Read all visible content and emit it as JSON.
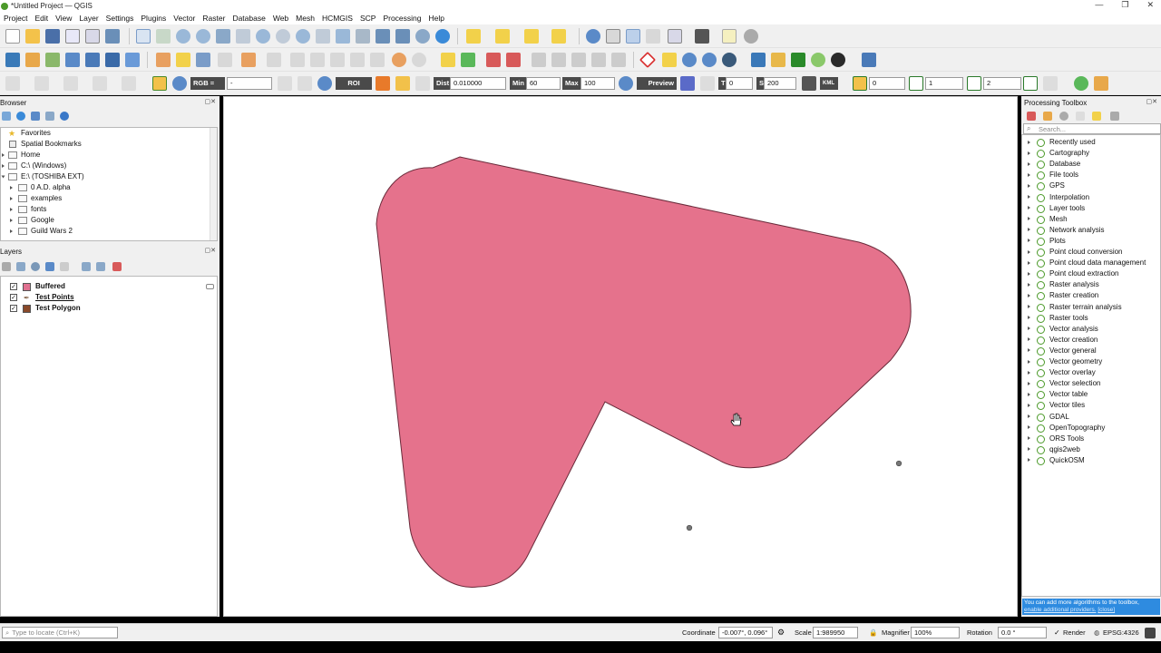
{
  "window": {
    "title": "*Untitled Project — QGIS",
    "buttons": [
      "—",
      "❐",
      "✕"
    ]
  },
  "menu": [
    "Project",
    "Edit",
    "View",
    "Layer",
    "Settings",
    "Plugins",
    "Vector",
    "Raster",
    "Database",
    "Web",
    "Mesh",
    "HCMGIS",
    "SCP",
    "Processing",
    "Help"
  ],
  "scp_toolbar": {
    "rgb_label": "RGB =",
    "rgb_value": "-",
    "roi_label": "ROI",
    "dist_label": "Dist",
    "dist_value": "0.010000",
    "min_label": "Min",
    "min_value": "60",
    "max_label": "Max",
    "max_value": "100",
    "preview_label": "Preview",
    "t_label": "T",
    "t_value": "0",
    "s_label": "S",
    "s_value": "200",
    "kml_label": "KML",
    "band_value": "0",
    "step1_value": "1",
    "step2_value": "2"
  },
  "browser": {
    "title": "Browser",
    "items": [
      "Favorites",
      "Spatial Bookmarks",
      "Home",
      "C:\\ (Windows)",
      "E:\\ (TOSHIBA EXT)",
      "0 A.D. alpha",
      "examples",
      "fonts",
      "Google",
      "Guild Wars 2"
    ]
  },
  "layers": {
    "title": "Layers",
    "items": [
      {
        "name": "Buffered",
        "checked": "✓",
        "color": "#e07090"
      },
      {
        "name": "Test Points",
        "checked": "✓",
        "color": "#8a6a50"
      },
      {
        "name": "Test Polygon",
        "checked": "✓",
        "color": "#8a4a2a"
      }
    ]
  },
  "processing": {
    "title": "Processing Toolbox",
    "search_placeholder": "Search...",
    "items": [
      "Recently used",
      "Cartography",
      "Database",
      "File tools",
      "GPS",
      "Interpolation",
      "Layer tools",
      "Mesh",
      "Network analysis",
      "Plots",
      "Point cloud conversion",
      "Point cloud data management",
      "Point cloud extraction",
      "Raster analysis",
      "Raster creation",
      "Raster terrain analysis",
      "Raster tools",
      "Vector analysis",
      "Vector creation",
      "Vector general",
      "Vector geometry",
      "Vector overlay",
      "Vector selection",
      "Vector table",
      "Vector tiles",
      "GDAL",
      "OpenTopography",
      "ORS Tools",
      "qgis2web",
      "QuickOSM"
    ],
    "info_text": "You can add more algorithms to the toolbox,",
    "info_link": "enable additional providers.",
    "info_close": "[close]"
  },
  "statusbar": {
    "locate_placeholder": "Type to locate (Ctrl+K)",
    "coordinate_label": "Coordinate",
    "coordinate_value": "-0.007°, 0.096°",
    "scale_label": "Scale",
    "scale_value": "1:989950",
    "magnifier_label": "Magnifier",
    "magnifier_value": "100%",
    "rotation_label": "Rotation",
    "rotation_value": "0.0 °",
    "render_label": "Render",
    "crs_label": "EPSG:4326"
  },
  "map": {
    "fill_color": "#e5728c",
    "stroke_color": "#6a2a3a",
    "point_color": "#777777"
  }
}
